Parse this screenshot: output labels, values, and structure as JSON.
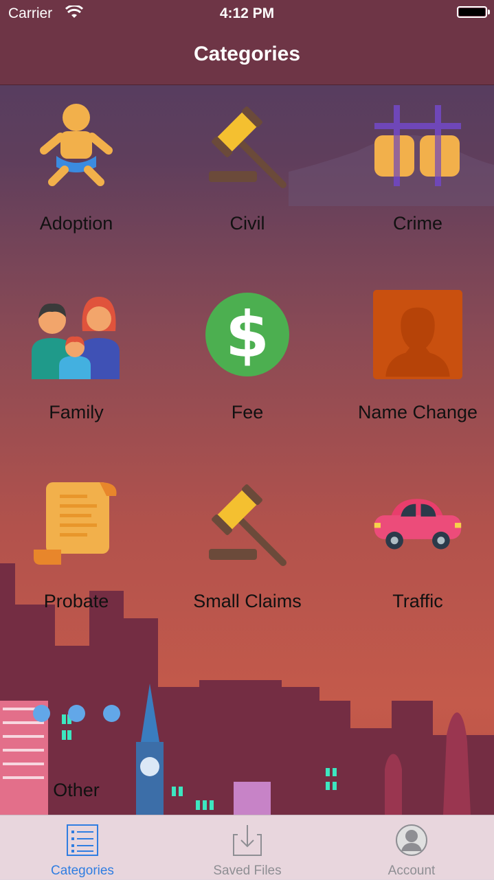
{
  "status_bar": {
    "carrier": "Carrier",
    "time": "4:12 PM"
  },
  "nav": {
    "title": "Categories"
  },
  "categories": [
    {
      "label": "Adoption",
      "icon": "baby-icon"
    },
    {
      "label": "Civil",
      "icon": "gavel-icon"
    },
    {
      "label": "Crime",
      "icon": "jail-bars-icon"
    },
    {
      "label": "Family",
      "icon": "family-icon"
    },
    {
      "label": "Fee",
      "icon": "dollar-icon"
    },
    {
      "label": "Name Change",
      "icon": "person-silhouette-icon"
    },
    {
      "label": "Probate",
      "icon": "scroll-icon"
    },
    {
      "label": "Small Claims",
      "icon": "gavel-icon"
    },
    {
      "label": "Traffic",
      "icon": "car-icon"
    },
    {
      "label": "Other",
      "icon": ""
    }
  ],
  "tabs": [
    {
      "label": "Categories",
      "icon": "list-icon",
      "active": true
    },
    {
      "label": "Saved Files",
      "icon": "download-icon",
      "active": false
    },
    {
      "label": "Account",
      "icon": "user-icon",
      "active": false
    }
  ],
  "colors": {
    "accent": "#2f7de1",
    "nav_bg": "#6e3546",
    "tab_inactive": "#8e8e93"
  }
}
